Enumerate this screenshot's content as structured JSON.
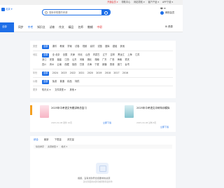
{
  "topbar": {
    "links": [
      "开通会员 ▾",
      "帮助中心",
      "网站导航 ▾",
      "客户产品 ▾",
      "APP下载 ▾"
    ]
  },
  "header": {
    "location": "北京 ▾",
    "search_placeholder": "搜索你想要的资源",
    "user_area": "☎  ✉",
    "user_name": "网校会员"
  },
  "nav": {
    "menu_label": "全部",
    "items": [
      "同步",
      "中考",
      "知识点",
      "试卷",
      "作文",
      "",
      "精品",
      "名师",
      "教辅",
      "",
      "中职"
    ],
    "active_index": 1,
    "hot_index": 10,
    "right_label": "⊞ 资源"
  },
  "filters": {
    "rows": [
      {
        "label": "类型",
        "options": [
          "全部",
          "课件",
          "教案",
          "学案",
          "试卷",
          "视频",
          "素材",
          "试题",
          "题库",
          "题组",
          "其他",
          "全部"
        ],
        "selected": 0
      },
      {
        "label": "地区",
        "options": [
          "全部",
          "全 北京",
          "全国",
          "天津",
          "河北",
          "山西",
          "内蒙古",
          "辽宁",
          "吉林",
          "黑龙江",
          "上海",
          "江苏"
        ],
        "selected": 0
      },
      {
        "label": "",
        "options": [
          "浙江",
          "安徽",
          "福建",
          "江西",
          "山东",
          "河南",
          "湖北",
          "湖南",
          "广东",
          "广西",
          "海南",
          "重庆"
        ],
        "selected": -1
      },
      {
        "label": "",
        "options": [
          "四川",
          "贵州",
          "云南",
          "西藏",
          "陕西",
          "甘肃",
          "青海",
          "宁夏",
          "新疆",
          "香港",
          "澳门",
          "台湾"
        ],
        "selected": -1
      },
      {
        "label": "年份",
        "options": [
          "全部",
          "2024",
          "2023",
          "2022",
          "2021",
          "2020",
          "2019",
          "2018",
          "2017",
          "2016"
        ],
        "selected": 0
      },
      {
        "label": "价格",
        "options": [
          "全部",
          "免费",
          "普通",
          "精品",
          "特供"
        ],
        "selected": 0
      }
    ],
    "more_label": "更多",
    "dropdowns": [
      "知识点 ▾",
      "文件类型 ▾",
      "其他 ▾"
    ]
  },
  "promos": [
    {
      "title": "2025年中考语文专题讲练总复习",
      "meta": "2025-04-08  课件  10页",
      "button": "立即下载"
    },
    {
      "title": "2025年中考语文冲刺特训模拟",
      "meta": "2025-04-08  试卷  8页",
      "button": "立即下载"
    }
  ],
  "results": {
    "tabs": [
      "综合",
      "最新",
      "下载量",
      "浏览量"
    ],
    "active_tab": 0,
    "sort": [
      "综合排序",
      "资源类型 ▾",
      "格式 ▾"
    ],
    "empty_text": "抱歉，没有找到符合您要求的资源",
    "empty_hint": "建议您更换关键词或调整筛选条件"
  },
  "colors": {
    "accent": "#1e6fe8",
    "promo_tag": "#f5a020",
    "hot": "#e4393c"
  }
}
